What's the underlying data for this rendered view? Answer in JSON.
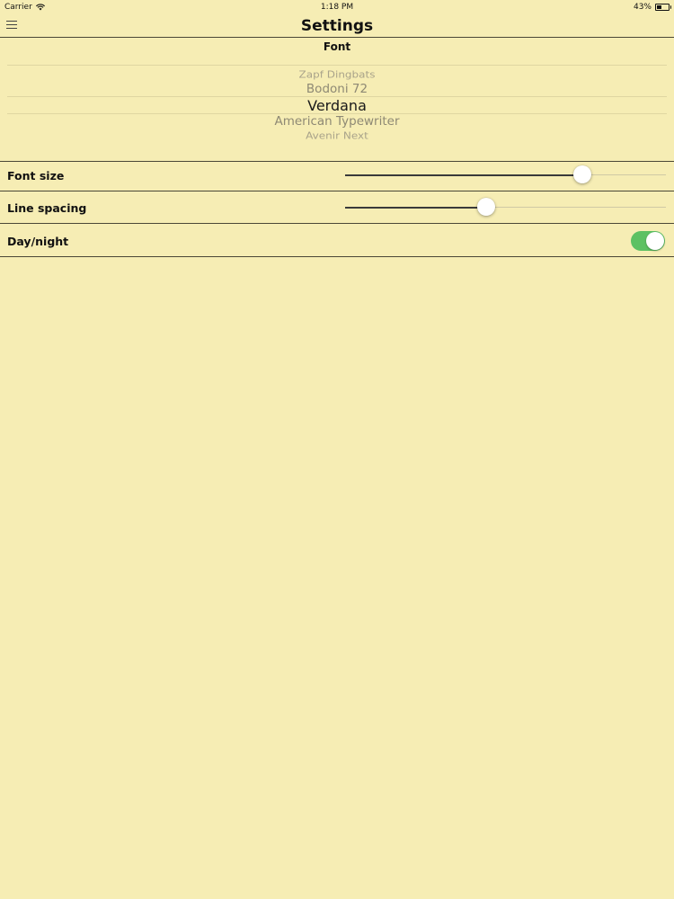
{
  "status_bar": {
    "carrier": "Carrier",
    "time": "1:18 PM",
    "battery_text": "43%",
    "battery_level": 0.43,
    "wifi_icon": "wifi-icon",
    "battery_icon": "battery-icon"
  },
  "nav": {
    "title": "Settings",
    "menu_icon": "hamburger-menu-icon"
  },
  "font_picker": {
    "header": "Font",
    "items": [
      {
        "label": "Zapf Dingbats"
      },
      {
        "label": "Bodoni 72"
      },
      {
        "label": "Verdana",
        "selected": true
      },
      {
        "label": "American Typewriter"
      },
      {
        "label": "Avenir Next"
      }
    ]
  },
  "settings": {
    "font_size": {
      "label": "Font size",
      "value": 0.74
    },
    "line_spacing": {
      "label": "Line spacing",
      "value": 0.44
    },
    "day_night": {
      "label": "Day/night",
      "on": true
    }
  },
  "colors": {
    "background": "#f6edb4",
    "toggle_on": "#5dc163",
    "divider": "#4a4736"
  }
}
